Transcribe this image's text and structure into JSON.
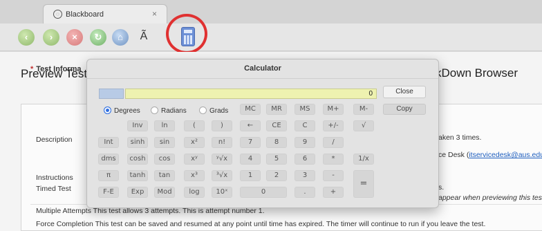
{
  "browser": {
    "tab_title": "Blackboard",
    "tab_close": "×",
    "font_button": "Ã"
  },
  "page": {
    "title_left": "Preview Test:",
    "title_right": "kDown Browser",
    "info_heading": "Test Informa",
    "rows": {
      "description_label": "Description",
      "description_text1": "aken 3 times.",
      "description_text2_prefix": "ce Desk (",
      "description_email": "itservicedesk@aus.edu",
      "instructions_label": "Instructions",
      "timed_label": "Timed Test",
      "timed_text1": "s.",
      "timed_text2": "appear when previewing this test)",
      "multiple_attempts": "Multiple Attempts This test allows 3 attempts. This is attempt number 1.",
      "force_completion": "Force Completion This test can be saved and resumed at any point until time has expired. The timer will continue to run if you leave the test."
    }
  },
  "calculator": {
    "title": "Calculator",
    "display_value": "0",
    "close_label": "Close",
    "copy_label": "Copy",
    "angle_modes": [
      "Degrees",
      "Radians",
      "Grads"
    ],
    "selected_mode": "Degrees",
    "keys": {
      "mc": "MC",
      "mr": "MR",
      "ms": "MS",
      "mplus": "M+",
      "mminus": "M-",
      "inv": "Inv",
      "ln": "ln",
      "lparen": "(",
      "rparen": ")",
      "back": "←",
      "ce": "CE",
      "c": "C",
      "plusminus": "+/-",
      "sqrt": "√",
      "int": "Int",
      "sinh": "sinh",
      "sin": "sin",
      "sq": "x²",
      "fact": "n!",
      "d7": "7",
      "d8": "8",
      "d9": "9",
      "div": "/",
      "dms": "dms",
      "cosh": "cosh",
      "cos": "cos",
      "pow": "xʸ",
      "yroot": "ʸ√x",
      "d4": "4",
      "d5": "5",
      "d6": "6",
      "mul": "*",
      "recip": "1/x",
      "pi": "π",
      "tanh": "tanh",
      "tan": "tan",
      "cube": "x³",
      "croot": "³√x",
      "d1": "1",
      "d2": "2",
      "d3": "3",
      "sub": "-",
      "eq": "=",
      "fe": "F-E",
      "exp": "Exp",
      "mod": "Mod",
      "log": "log",
      "tenx": "10ˣ",
      "d0": "0",
      "dot": ".",
      "add": "+"
    }
  },
  "colors": {
    "highlight_ring": "#e03131",
    "display_bg": "#eef2b0",
    "radio_selected": "#2f6fe0",
    "link": "#1f5fbf"
  },
  "icons": [
    "back-icon",
    "forward-icon",
    "stop-icon",
    "reload-icon",
    "home-icon",
    "font-icon",
    "calculator-icon"
  ]
}
